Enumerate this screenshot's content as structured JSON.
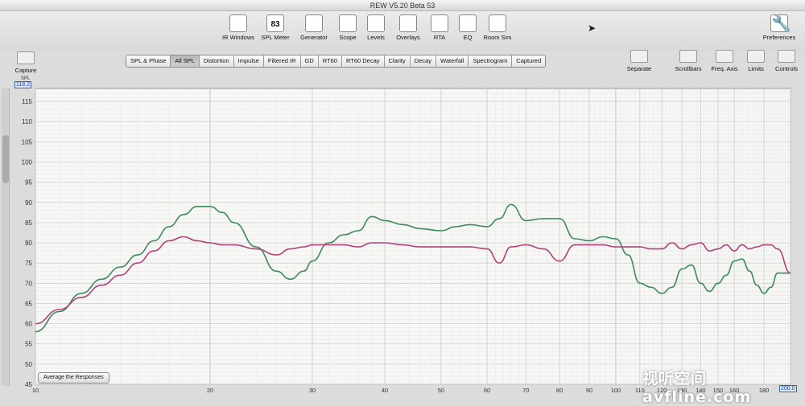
{
  "window": {
    "title": "REW V5.20 Beta 53"
  },
  "toolbar": {
    "buttons": [
      {
        "label": "IR Windows",
        "icon": "ir-windows-icon"
      },
      {
        "label": "SPL Meter",
        "icon": "spl-meter-icon",
        "badge_top": "dB SPL",
        "badge_value": "83"
      },
      {
        "label": "Generator",
        "icon": "generator-icon"
      },
      {
        "label": "Scope",
        "icon": "scope-icon"
      },
      {
        "label": "Levels",
        "icon": "levels-icon"
      },
      {
        "label": "Overlays",
        "icon": "overlays-icon"
      },
      {
        "label": "RTA",
        "icon": "rta-icon"
      },
      {
        "label": "EQ",
        "icon": "eq-icon",
        "badge_value": "EQ"
      },
      {
        "label": "Room Sim",
        "icon": "room-sim-icon"
      }
    ],
    "preferences": {
      "label": "Preferences",
      "icon": "wrench-hammer-icon"
    }
  },
  "left_controls": {
    "capture_label": "Capture"
  },
  "tabs": {
    "items": [
      "SPL & Phase",
      "All SPL",
      "Distortion",
      "Impulse",
      "Filtered IR",
      "GD",
      "RT60",
      "RT60 Decay",
      "Clarity",
      "Decay",
      "Waterfall",
      "Spectrogram",
      "Captured"
    ],
    "active_index": 1
  },
  "right_controls": {
    "items": [
      {
        "label": "Separate",
        "icon": "separate-icon"
      },
      {
        "label": "Scrollbars",
        "icon": "scrollbars-icon"
      },
      {
        "label": "Freq. Axis",
        "icon": "freq-axis-icon"
      },
      {
        "label": "Limits",
        "icon": "limits-icon"
      },
      {
        "label": "Controls",
        "icon": "controls-gear-icon"
      }
    ]
  },
  "plot": {
    "y_axis_title": "SPL",
    "y_max_readout": "118.2",
    "x_max_readout": "200.0",
    "average_button_label": "Average the Responses"
  },
  "chart_data": {
    "type": "line",
    "x_scale": "log",
    "xlim": [
      10,
      200
    ],
    "ylim": [
      45,
      118.2
    ],
    "y_ticks": [
      45,
      50,
      55,
      60,
      65,
      70,
      75,
      80,
      85,
      90,
      95,
      100,
      105,
      110,
      115
    ],
    "x_tick_labels": [
      {
        "value": 10,
        "label": "10"
      },
      {
        "value": 20,
        "label": "20"
      },
      {
        "value": 30,
        "label": "30"
      },
      {
        "value": 40,
        "label": "40"
      },
      {
        "value": 50,
        "label": "50"
      },
      {
        "value": 60,
        "label": "60"
      },
      {
        "value": 70,
        "label": "70"
      },
      {
        "value": 80,
        "label": "80"
      },
      {
        "value": 90,
        "label": "90"
      },
      {
        "value": 100,
        "label": "100"
      },
      {
        "value": 110,
        "label": "110"
      },
      {
        "value": 120,
        "label": "120"
      },
      {
        "value": 130,
        "label": "130"
      },
      {
        "value": 140,
        "label": "140"
      },
      {
        "value": 150,
        "label": "150"
      },
      {
        "value": 160,
        "label": "160"
      },
      {
        "value": 180,
        "label": "180"
      }
    ],
    "grid": true,
    "series": [
      {
        "color": "#3e8a5a",
        "x": [
          10,
          11,
          12,
          13,
          14,
          15,
          16,
          17,
          18,
          19,
          20,
          21,
          22,
          24,
          26,
          27.5,
          29,
          30,
          32,
          34,
          36,
          38,
          40,
          43,
          46,
          50,
          53,
          56,
          60,
          63,
          66,
          70,
          75,
          80,
          85,
          90,
          95,
          100,
          105,
          110,
          115,
          120,
          125,
          130,
          135,
          140,
          145,
          150,
          155,
          160,
          165,
          170,
          175,
          180,
          185,
          190,
          200
        ],
        "y": [
          58,
          63,
          67.5,
          71,
          74,
          77,
          80.5,
          84,
          87,
          89,
          89,
          87.5,
          85,
          79,
          73,
          71,
          73,
          75.5,
          80,
          82,
          83,
          86.5,
          85.5,
          84.5,
          83.5,
          83,
          84,
          84.5,
          84,
          86,
          89.5,
          85.5,
          86,
          86,
          81,
          80.5,
          81.5,
          81,
          77,
          70,
          69,
          67.5,
          69,
          73.5,
          74.5,
          70,
          68,
          70,
          72,
          75.5,
          76,
          73,
          69.5,
          67.5,
          69,
          72.5,
          72.5
        ]
      },
      {
        "color": "#b0407a",
        "x": [
          10,
          11,
          12,
          13,
          14,
          15,
          16,
          17,
          18,
          19,
          20,
          21,
          22,
          24,
          26,
          27.5,
          29,
          30,
          32,
          34,
          36,
          38,
          40,
          43,
          46,
          50,
          53,
          56,
          60,
          63,
          66,
          70,
          75,
          80,
          85,
          90,
          95,
          100,
          105,
          110,
          115,
          120,
          125,
          130,
          135,
          140,
          145,
          150,
          155,
          160,
          165,
          170,
          175,
          180,
          185,
          190,
          200
        ],
        "y": [
          60,
          63.5,
          66.5,
          69.5,
          72,
          75,
          78,
          80.5,
          81.5,
          80.5,
          80,
          79.5,
          79.5,
          78.5,
          77,
          78.5,
          79,
          79.5,
          79.5,
          79.5,
          79,
          80,
          80,
          79.5,
          79,
          79,
          79,
          79,
          78.5,
          75,
          79,
          79.5,
          78.5,
          75.5,
          79.5,
          79.5,
          79.5,
          79,
          79,
          79,
          78.5,
          78.5,
          80,
          78.5,
          79.5,
          80,
          78,
          78.5,
          79.5,
          78,
          79.5,
          78.5,
          79,
          79.5,
          79.5,
          78.5,
          72.5
        ]
      }
    ]
  },
  "watermark": {
    "text": "视听空间 avfline.com"
  }
}
